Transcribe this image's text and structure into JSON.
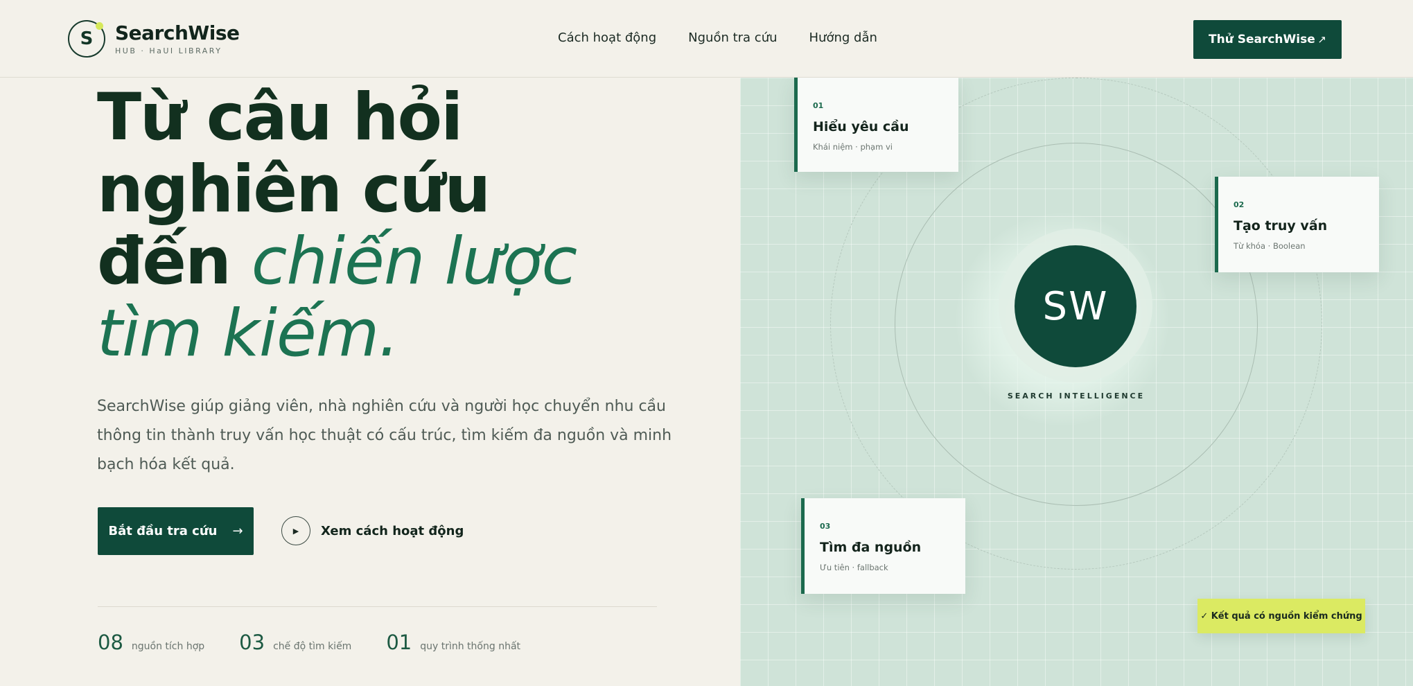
{
  "header": {
    "logo_letter": "S",
    "brand_name": "SearchWise",
    "brand_sub": "HUB · HaUI LIBRARY",
    "nav": [
      "Cách hoạt động",
      "Nguồn tra cứu",
      "Hướng dẫn"
    ],
    "cta_label": "Thử SearchWise",
    "cta_arrow": "↗"
  },
  "hero": {
    "title_line1": "Từ câu hỏi nghiên cứu",
    "title_prefix": "đến ",
    "title_accent": "chiến lược tìm kiếm.",
    "description": "SearchWise giúp giảng viên, nhà nghiên cứu và người học chuyển nhu cầu thông tin thành truy vấn học thuật có cấu trúc, tìm kiếm đa nguồn và minh bạch hóa kết quả.",
    "primary_button": "Bắt đầu tra cứu",
    "primary_arrow": "→",
    "play_glyph": "▶",
    "secondary_button": "Xem cách hoạt động"
  },
  "stats": [
    {
      "value": "08",
      "label": "nguồn tích hợp"
    },
    {
      "value": "03",
      "label": "chế độ tìm kiếm"
    },
    {
      "value": "01",
      "label": "quy trình thống nhất"
    }
  ],
  "panel": {
    "core_label": "SW",
    "core_caption": "SEARCH INTELLIGENCE",
    "steps": [
      {
        "num": "01",
        "title": "Hiểu yêu cầu",
        "meta": "Khái niệm · phạm vi"
      },
      {
        "num": "02",
        "title": "Tạo truy vấn",
        "meta": "Từ khóa · Boolean"
      },
      {
        "num": "03",
        "title": "Tìm đa nguồn",
        "meta": "Ưu tiên · fallback"
      }
    ],
    "badge": "✓ Kết quả có nguồn kiểm chứng"
  },
  "colors": {
    "primary": "#0f4a3a",
    "accent_text": "#1c7352",
    "highlight": "#dbea62",
    "background": "#f3f1ea",
    "panel": "#cfe3d8"
  }
}
